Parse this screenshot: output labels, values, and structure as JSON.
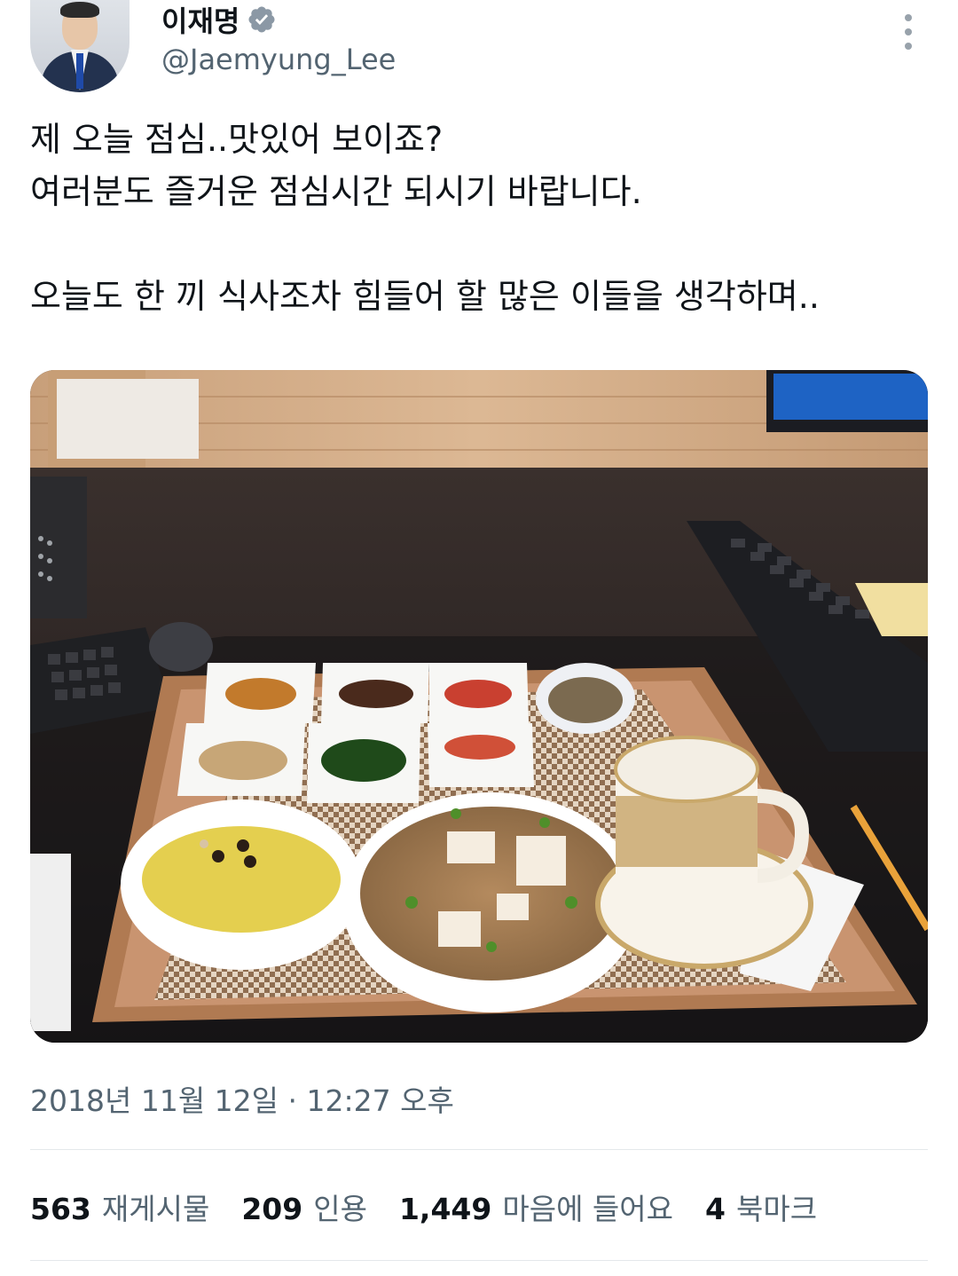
{
  "author": {
    "name": "이재명",
    "handle": "@Jaemyung_Lee",
    "verified": true,
    "avatar_icon": "profile-photo",
    "verified_icon": "verified-badge-icon"
  },
  "tweet": {
    "lines": [
      "제 오늘 점심..맛있어 보이죠?",
      "여러분도 즐거운 점심시간 되시기 바랍니다.",
      "",
      "오늘도 한 끼 식사조차 힘들어 할 많은 이들을 생각하며.."
    ],
    "timestamp": "2018년 11월 12일 · 12:27 오후"
  },
  "stats": [
    {
      "count": "563",
      "label": "재게시물"
    },
    {
      "count": "209",
      "label": "인용"
    },
    {
      "count": "1,449",
      "label": "마음에 들어요"
    },
    {
      "count": "4",
      "label": "북마크"
    }
  ],
  "colors": {
    "text_primary": "#0f1419",
    "text_secondary": "#536471",
    "divider": "#e4e8eb"
  }
}
